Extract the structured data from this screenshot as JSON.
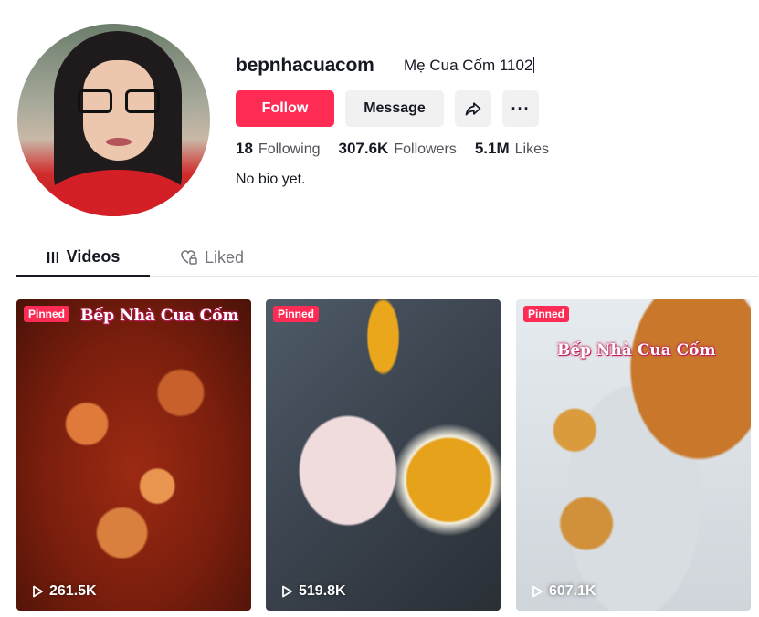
{
  "profile": {
    "username": "bepnhacuacom",
    "nickname": "Mẹ Cua Cốm 1102",
    "bio": "No bio yet.",
    "avatar_icon": "profile-photo"
  },
  "actions": {
    "follow_label": "Follow",
    "message_label": "Message",
    "share_icon": "share-icon",
    "more_icon": "more-icon",
    "more_glyph": "···"
  },
  "stats": {
    "following": {
      "value": "18",
      "label": "Following"
    },
    "followers": {
      "value": "307.6K",
      "label": "Followers"
    },
    "likes": {
      "value": "5.1M",
      "label": "Likes"
    }
  },
  "tabs": [
    {
      "label": "Videos",
      "icon": "grid-icon",
      "active": true
    },
    {
      "label": "Liked",
      "icon": "heart-lock-icon",
      "active": false
    }
  ],
  "videos": [
    {
      "badge": "Pinned",
      "watermark": "Bếp Nhà Cua Cốm",
      "views": "261.5K"
    },
    {
      "badge": "Pinned",
      "watermark": "",
      "views": "519.8K"
    },
    {
      "badge": "Pinned",
      "watermark": "Bếp Nhà Cua Cốm",
      "views": "607.1K"
    }
  ],
  "colors": {
    "accent": "#fe2c55",
    "button_bg": "#f1f1f2",
    "text": "#161823",
    "muted": "#73747b"
  }
}
